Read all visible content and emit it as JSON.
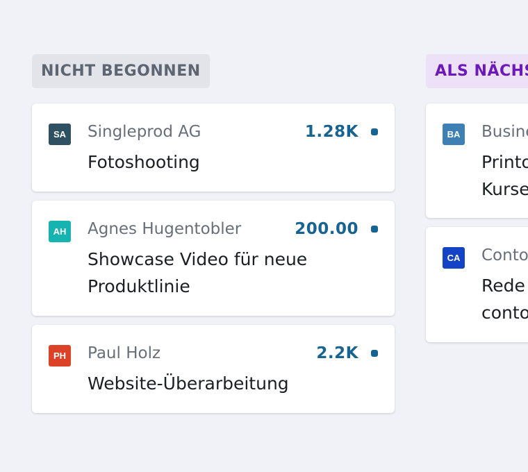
{
  "columns": [
    {
      "header": "NICHT BEGONNEN",
      "cards": [
        {
          "avatar": "SA",
          "avatar_color": "#2f4f63",
          "client": "Singleprod AG",
          "amount": "1.28K",
          "title": "Fotoshooting"
        },
        {
          "avatar": "AH",
          "avatar_color": "#16b3b1",
          "client": "Agnes Hugentobler",
          "amount": "200.00",
          "title": "Showcase Video für neue Produktlinie"
        },
        {
          "avatar": "PH",
          "avatar_color": "#dc4228",
          "client": "Paul Holz",
          "amount": "2.2K",
          "title": "Website-Überarbeitung"
        }
      ]
    },
    {
      "header": "ALS NÄCHSTES",
      "cards": [
        {
          "avatar": "BA",
          "avatar_color": "#3e7fb4",
          "client": "Business",
          "amount": "",
          "title": "Printo Kurse"
        },
        {
          "avatar": "CA",
          "avatar_color": "#1443c6",
          "client": "Contoso",
          "amount": "",
          "title": "Rede contoso"
        }
      ]
    }
  ]
}
